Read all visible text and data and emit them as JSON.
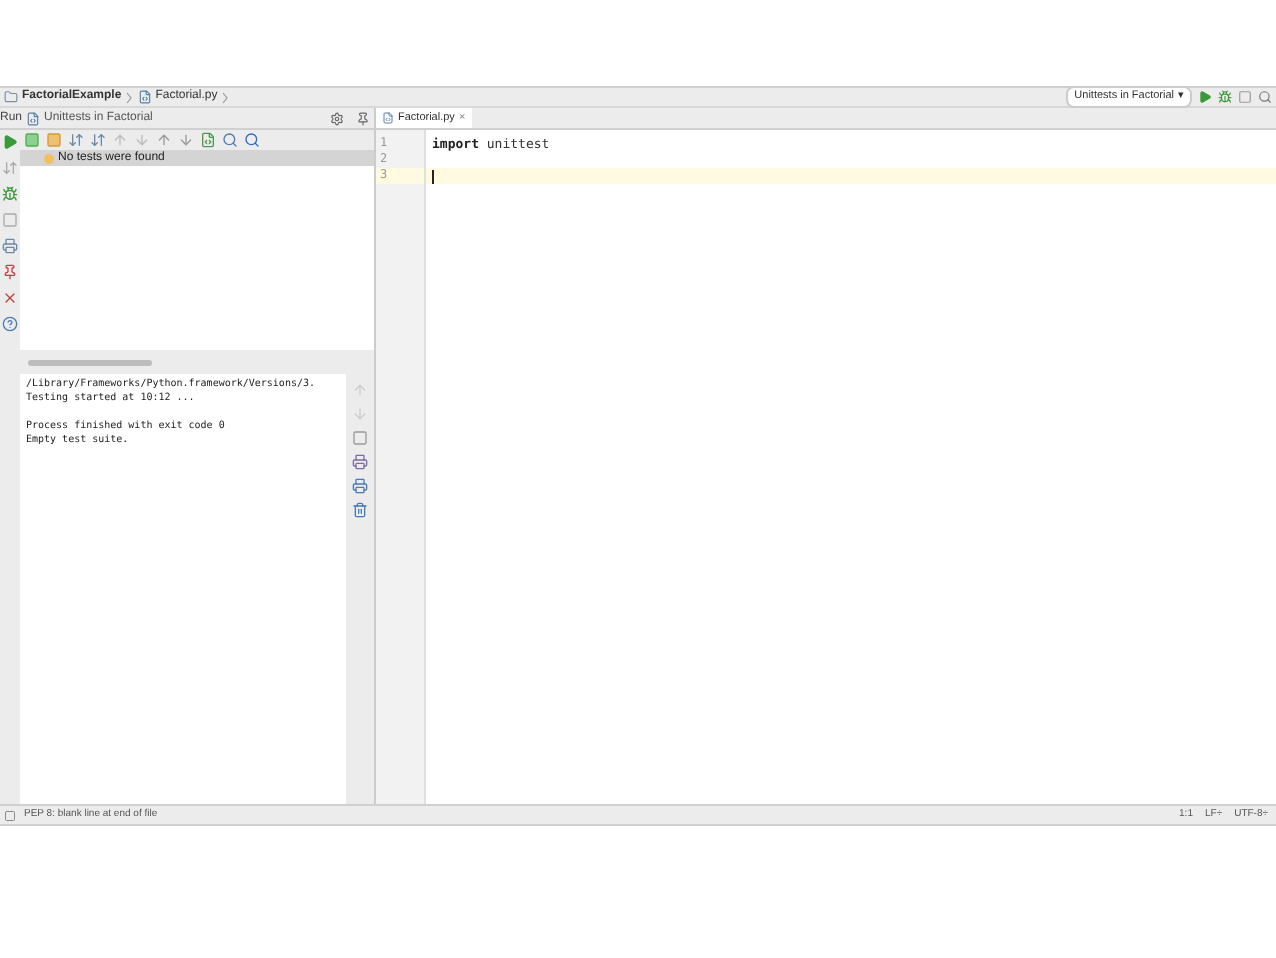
{
  "breadcrumb": [
    "FactorialExample",
    "Factorial.py"
  ],
  "run_config": {
    "label": "Unittests in Factorial",
    "caret": "▾"
  },
  "run_panel": {
    "prefix": "Run",
    "tab": "Unittests in Factorial"
  },
  "test_tree": [
    {
      "label": "No tests were found",
      "selected": true
    }
  ],
  "console": [
    [
      "/Library/Frameworks/Python.framework/Versions/3.",
      "Testing started at 10:12 ..."
    ],
    [
      "Process finished with exit code 0",
      "Empty test suite."
    ]
  ],
  "editor_tab": {
    "label": "Factorial.py",
    "close": "×",
    "selected": true
  },
  "code_lines": [
    {
      "number": "1",
      "keyword": "import",
      "text": " unittest",
      "current": false
    },
    {
      "number": "2",
      "current": false
    },
    {
      "number": "3",
      "current": true
    }
  ],
  "status_bar": {
    "message": "PEP 8: blank line at end of file",
    "items": [
      "1:1",
      "LF÷",
      "UTF-8÷"
    ]
  }
}
